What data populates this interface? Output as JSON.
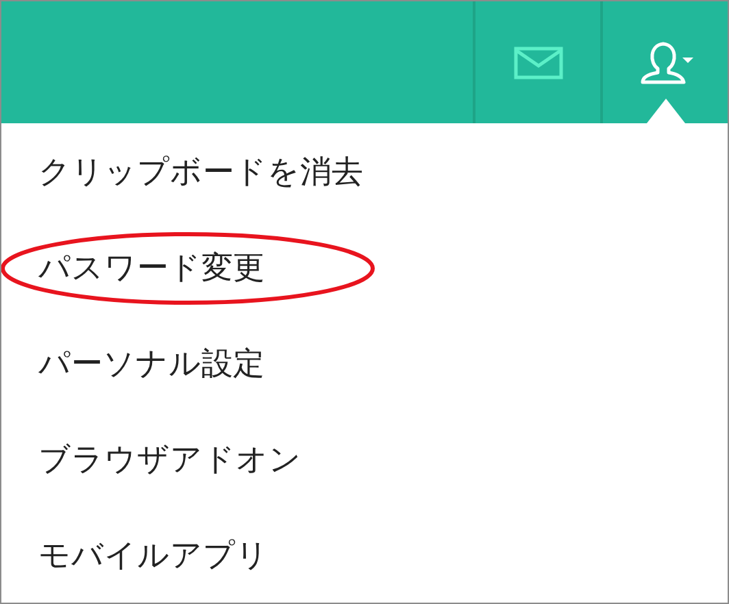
{
  "menu": [
    {
      "label": "クリップボードを消去",
      "circled": false
    },
    {
      "label": "パスワード変更",
      "circled": true
    },
    {
      "label": "パーソナル設定",
      "circled": false
    },
    {
      "label": "ブラウザアドオン",
      "circled": false
    },
    {
      "label": "モバイルアプリ",
      "circled": false
    }
  ]
}
